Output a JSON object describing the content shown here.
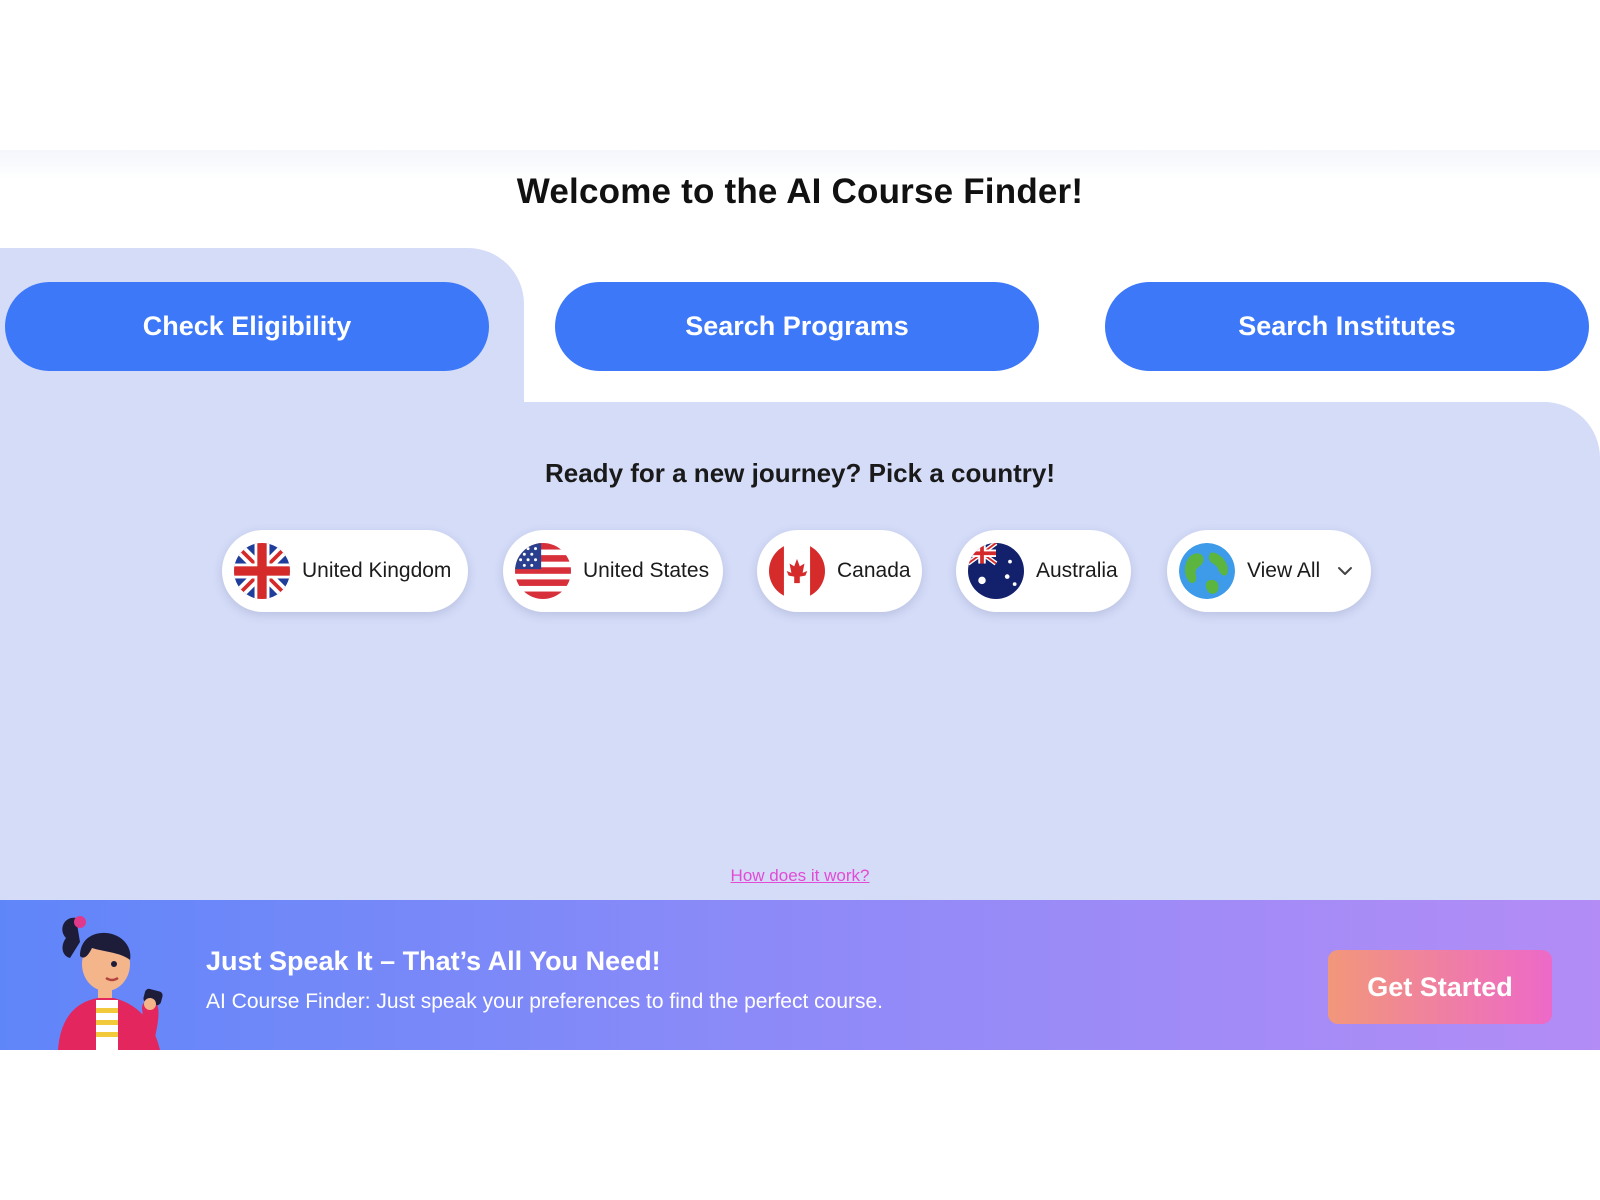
{
  "header": {
    "title": "Welcome to the AI Course Finder!"
  },
  "tabs": [
    {
      "label": "Check Eligibility",
      "active": true
    },
    {
      "label": "Search Programs",
      "active": false
    },
    {
      "label": "Search Institutes",
      "active": false
    }
  ],
  "countries": {
    "prompt": "Ready for a new journey? Pick a country!",
    "items": [
      {
        "label": "United Kingdom",
        "icon": "uk-flag-icon"
      },
      {
        "label": "United States",
        "icon": "us-flag-icon"
      },
      {
        "label": "Canada",
        "icon": "canada-flag-icon"
      },
      {
        "label": "Australia",
        "icon": "australia-flag-icon"
      },
      {
        "label": "View All",
        "icon": "globe-icon",
        "dropdown_icon": "chevron-down-icon"
      }
    ]
  },
  "help": {
    "link_text": "How does it work?"
  },
  "banner": {
    "title": "Just Speak It – That’s All You Need!",
    "subtitle": "AI Course Finder: Just speak your preferences to find the perfect course.",
    "cta_label": "Get Started",
    "illustration_icon": "woman-with-microphone-illustration"
  },
  "colors": {
    "primary_button": "#3d78f9",
    "panel": "#d4dcf8",
    "link": "#e24bd6",
    "banner_start": "#5f86f9",
    "banner_end": "#b38cf6",
    "cta_start": "#f2977a",
    "cta_end": "#ed69c8"
  }
}
